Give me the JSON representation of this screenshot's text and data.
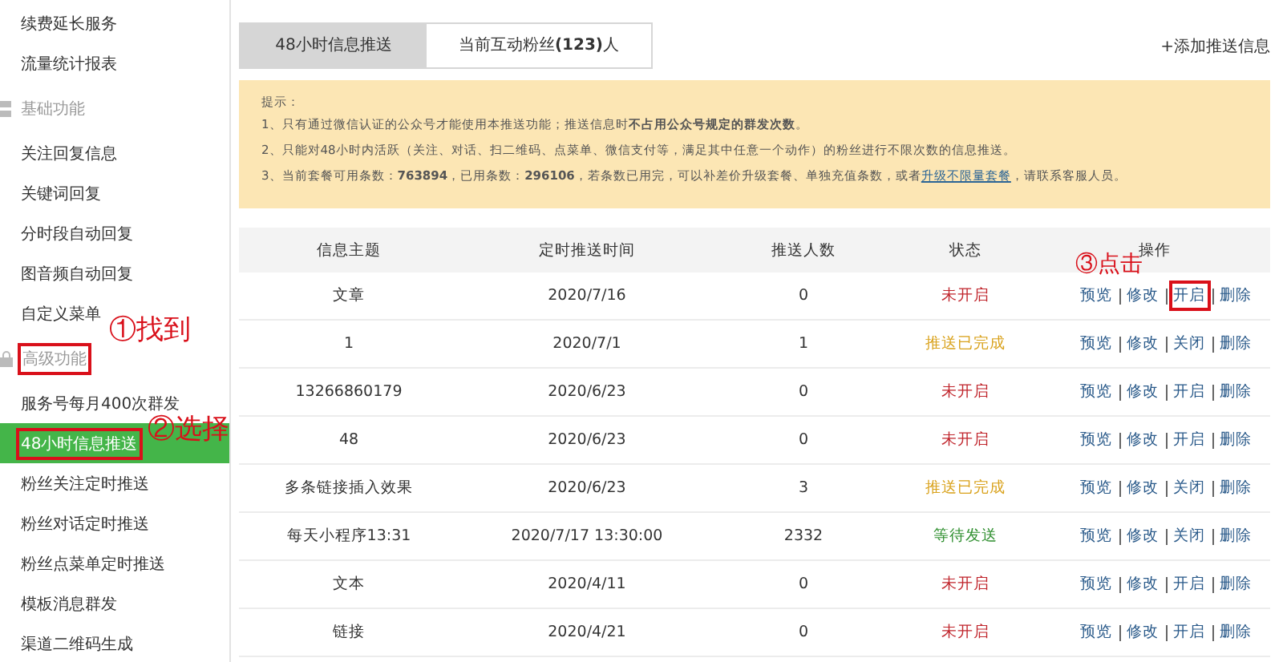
{
  "sidebar": {
    "items": [
      {
        "label": "续费延长服务",
        "kind": "item",
        "selected": false,
        "boxed": false
      },
      {
        "label": "流量统计报表",
        "kind": "item",
        "selected": false,
        "boxed": false
      },
      {
        "label": "基础功能",
        "kind": "section",
        "boxed": false
      },
      {
        "label": "关注回复信息",
        "kind": "item",
        "selected": false,
        "boxed": false
      },
      {
        "label": "关键词回复",
        "kind": "item",
        "selected": false,
        "boxed": false
      },
      {
        "label": "分时段自动回复",
        "kind": "item",
        "selected": false,
        "boxed": false
      },
      {
        "label": "图音频自动回复",
        "kind": "item",
        "selected": false,
        "boxed": false
      },
      {
        "label": "自定义菜单",
        "kind": "item",
        "selected": false,
        "boxed": false
      },
      {
        "label": "高级功能",
        "kind": "section",
        "boxed": true,
        "note": "①找到"
      },
      {
        "label": "服务号每月400次群发",
        "kind": "item",
        "selected": false,
        "boxed": false
      },
      {
        "label": "48小时信息推送",
        "kind": "item",
        "selected": true,
        "boxed": true,
        "note": "②选择"
      },
      {
        "label": "粉丝关注定时推送",
        "kind": "item",
        "selected": false,
        "boxed": false
      },
      {
        "label": "粉丝对话定时推送",
        "kind": "item",
        "selected": false,
        "boxed": false
      },
      {
        "label": "粉丝点菜单定时推送",
        "kind": "item",
        "selected": false,
        "boxed": false
      },
      {
        "label": "模板消息群发",
        "kind": "item",
        "selected": false,
        "boxed": false
      },
      {
        "label": "渠道二维码生成",
        "kind": "item",
        "selected": false,
        "boxed": false
      }
    ]
  },
  "tabs": [
    {
      "label": "48小时信息推送",
      "selected": true
    },
    {
      "label": "当前互动粉丝**(123)**人",
      "selected": false
    }
  ],
  "add_button": "+添加推送信息",
  "notice": {
    "title": "提示：",
    "lines": [
      {
        "text": "1、只有通过微信认证的公众号才能使用本推送功能；推送信息时**不占用公众号规定的群发次数**。"
      },
      {
        "text": "2、只能对48小时内活跃（关注、对话、扫二维码、点菜单、微信支付等，满足其中任意一个动作）的粉丝进行不限次数的信息推送。"
      },
      {
        "text": "3、当前套餐可用条数：**763894**，已用条数：**296106**，若条数已用完，可以补差价升级套餐、单独充值条数，或者",
        "link": "升级不限量套餐",
        "after": "，请联系客服人员。"
      }
    ]
  },
  "table": {
    "columns": [
      "信息主题",
      "定时推送时间",
      "推送人数",
      "状态",
      "操作"
    ],
    "rows": [
      {
        "title": "文章",
        "time": "2020/7/16",
        "count": "0",
        "status": "未开启",
        "kind": "off",
        "actions": [
          {
            "label": "预览",
            "boxed": false
          },
          {
            "label": "修改",
            "boxed": false
          },
          {
            "label": "开启",
            "boxed": true,
            "note": "③点击"
          },
          {
            "label": "删除",
            "boxed": false
          }
        ]
      },
      {
        "title": "1",
        "time": "2020/7/1",
        "count": "1",
        "status": "推送已完成",
        "kind": "done",
        "actions": [
          {
            "label": "预览",
            "boxed": false
          },
          {
            "label": "修改",
            "boxed": false
          },
          {
            "label": "关闭",
            "boxed": false
          },
          {
            "label": "删除",
            "boxed": false
          }
        ]
      },
      {
        "title": "13266860179",
        "time": "2020/6/23",
        "count": "0",
        "status": "未开启",
        "kind": "off",
        "actions": [
          {
            "label": "预览",
            "boxed": false
          },
          {
            "label": "修改",
            "boxed": false
          },
          {
            "label": "开启",
            "boxed": false
          },
          {
            "label": "删除",
            "boxed": false
          }
        ]
      },
      {
        "title": "48",
        "time": "2020/6/23",
        "count": "0",
        "status": "未开启",
        "kind": "off",
        "actions": [
          {
            "label": "预览",
            "boxed": false
          },
          {
            "label": "修改",
            "boxed": false
          },
          {
            "label": "开启",
            "boxed": false
          },
          {
            "label": "删除",
            "boxed": false
          }
        ]
      },
      {
        "title": "多条链接插入效果",
        "time": "2020/6/23",
        "count": "3",
        "status": "推送已完成",
        "kind": "done",
        "actions": [
          {
            "label": "预览",
            "boxed": false
          },
          {
            "label": "修改",
            "boxed": false
          },
          {
            "label": "关闭",
            "boxed": false
          },
          {
            "label": "删除",
            "boxed": false
          }
        ]
      },
      {
        "title": "每天小程序13:31",
        "time": "2020/7/17 13:30:00",
        "count": "2332",
        "status": "等待发送",
        "kind": "waiting",
        "actions": [
          {
            "label": "预览",
            "boxed": false
          },
          {
            "label": "修改",
            "boxed": false
          },
          {
            "label": "关闭",
            "boxed": false
          },
          {
            "label": "删除",
            "boxed": false
          }
        ]
      },
      {
        "title": "文本",
        "time": "2020/4/11",
        "count": "0",
        "status": "未开启",
        "kind": "off",
        "actions": [
          {
            "label": "预览",
            "boxed": false
          },
          {
            "label": "修改",
            "boxed": false
          },
          {
            "label": "开启",
            "boxed": false
          },
          {
            "label": "删除",
            "boxed": false
          }
        ]
      },
      {
        "title": "链接",
        "time": "2020/4/21",
        "count": "0",
        "status": "未开启",
        "kind": "off",
        "actions": [
          {
            "label": "预览",
            "boxed": false
          },
          {
            "label": "修改",
            "boxed": false
          },
          {
            "label": "开启",
            "boxed": false
          },
          {
            "label": "删除",
            "boxed": false
          }
        ]
      }
    ]
  }
}
